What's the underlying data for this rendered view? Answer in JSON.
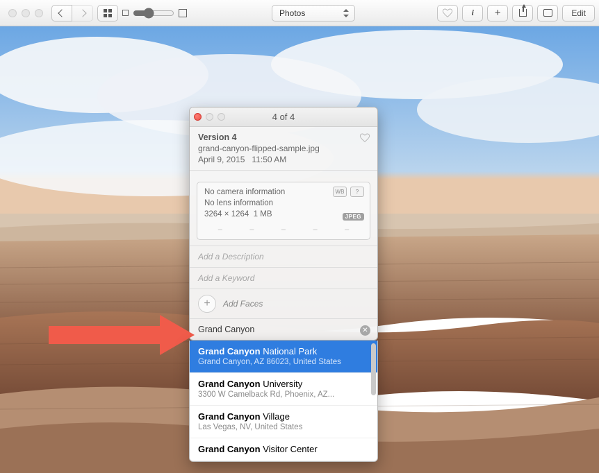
{
  "toolbar": {
    "view_mode": "Photos",
    "edit_label": "Edit"
  },
  "info": {
    "title": "4 of 4",
    "version": "Version 4",
    "filename": "grand-canyon-flipped-sample.jpg",
    "date": "April 9, 2015",
    "time": "11:50 AM",
    "camera": "No camera information",
    "lens": "No lens information",
    "dimensions": "3264 × 1264",
    "size": "1 MB",
    "format_badge": "JPEG",
    "wb_icon": "WB",
    "help_icon": "?",
    "description_placeholder": "Add a Description",
    "keyword_placeholder": "Add a Keyword",
    "faces_label": "Add Faces",
    "location_value": "Grand Canyon"
  },
  "suggestions": [
    {
      "bold": "Grand Canyon",
      "rest": " National Park",
      "sub": "Grand Canyon, AZ 86023, United States",
      "selected": true
    },
    {
      "bold": "Grand Canyon",
      "rest": " University",
      "sub": "3300 W Camelback Rd, Phoenix, AZ...",
      "selected": false
    },
    {
      "bold": "Grand Canyon",
      "rest": " Village",
      "sub": "Las Vegas, NV, United States",
      "selected": false
    },
    {
      "bold": "Grand Canyon",
      "rest": " Visitor Center",
      "sub": "",
      "selected": false
    }
  ]
}
